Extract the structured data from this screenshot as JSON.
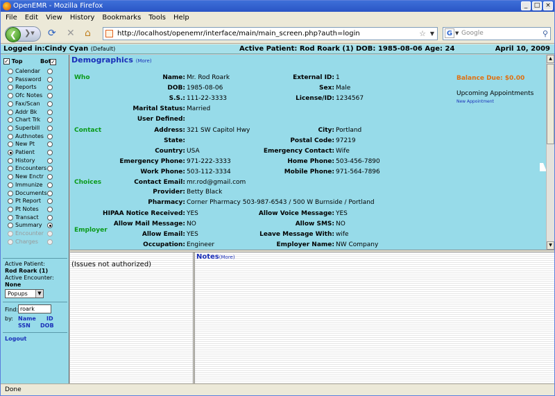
{
  "window": {
    "title": "OpenEMR - Mozilla Firefox"
  },
  "menu": [
    "File",
    "Edit",
    "View",
    "History",
    "Bookmarks",
    "Tools",
    "Help"
  ],
  "url": "http://localhost/openemr/interface/main/main_screen.php?auth=login",
  "search_placeholder": "Google",
  "topbar": {
    "logged_in": "Logged in:Cindy Cyan",
    "group": "(Default)",
    "active_patient": "Active Patient: Rod Roark (1) DOB: 1985-08-06 Age: 24",
    "date": "April 10, 2009"
  },
  "nav": {
    "top_label": "Top",
    "bot_label": "Bot",
    "items": [
      "Calendar",
      "Password",
      "Reports",
      "Ofc Notes",
      "Fax/Scan",
      "Addr Bk",
      "Chart Trk",
      "Superbill",
      "Authnotes",
      "New Pt",
      "Patient",
      "History",
      "Encounters",
      "New Enctr",
      "Immunize",
      "Documents",
      "Pt Report",
      "Pt Notes",
      "Transact",
      "Summary",
      "Encounter",
      "Charges"
    ],
    "active_patient_label": "Active Patient:",
    "active_patient_name": "Rod Roark (1)",
    "active_encounter_label": "Active Encounter:",
    "active_encounter_value": "None",
    "popups": "Popups",
    "find_label": "Find:",
    "find_value": "roark",
    "by_label": "by:",
    "by_name": "Name",
    "by_id": "ID",
    "by_ssn": "SSN",
    "by_dob": "DOB",
    "logout": "Logout"
  },
  "demographics": {
    "title": "Demographics",
    "more": "(More)",
    "sections": {
      "who": "Who",
      "contact": "Contact",
      "choices": "Choices",
      "employer": "Employer"
    },
    "name_l": "Name:",
    "name": "Mr. Rod  Roark",
    "extid_l": "External ID:",
    "extid": "1",
    "dob_l": "DOB:",
    "dob": "1985-08-06",
    "sex_l": "Sex:",
    "sex": "Male",
    "ss_l": "S.S.:",
    "ss": "111-22-3333",
    "license_l": "License/ID:",
    "license": "1234567",
    "marital_l": "Marital Status:",
    "marital": "Married",
    "userdef_l": "User Defined:",
    "address_l": "Address:",
    "address": "321 SW Capitol Hwy",
    "city_l": "City:",
    "city": "Portland",
    "state_l": "State:",
    "postal_l": "Postal Code:",
    "postal": "97219",
    "country_l": "Country:",
    "country": "USA",
    "emcontact_l": "Emergency Contact:",
    "emcontact": "Wife",
    "emphone_l": "Emergency Phone:",
    "emphone": "971-222-3333",
    "homephone_l": "Home Phone:",
    "homephone": "503-456-7890",
    "workphone_l": "Work Phone:",
    "workphone": "503-112-3334",
    "mobile_l": "Mobile Phone:",
    "mobile": "971-564-7896",
    "email_l": "Contact Email:",
    "email": "mr.rod@gmail.com",
    "provider_l": "Provider:",
    "provider": "Betty Black",
    "pharmacy_l": "Pharmacy:",
    "pharmacy": "Corner Pharmacy 503-987-6543 / 500 W Burnside / Portland",
    "hipaa_l": "HIPAA Notice Received:",
    "hipaa": "YES",
    "voice_l": "Allow Voice Message:",
    "voice": "YES",
    "mail_l": "Allow Mail Message:",
    "mail": "NO",
    "sms_l": "Allow SMS:",
    "sms": "NO",
    "allowemail_l": "Allow Email:",
    "allowemail": "YES",
    "leave_l": "Leave Message With:",
    "leave": "wife",
    "occupation_l": "Occupation:",
    "occupation": "Engineer",
    "empname_l": "Employer Name:",
    "empname": "NW Company",
    "balance": "Balance Due: $0.00",
    "upcoming": "Upcoming Appointments",
    "new_appt": "New Appointment"
  },
  "issues": "(Issues not authorized)",
  "notes": {
    "title": "Notes",
    "more": "(More)"
  },
  "status": "Done"
}
